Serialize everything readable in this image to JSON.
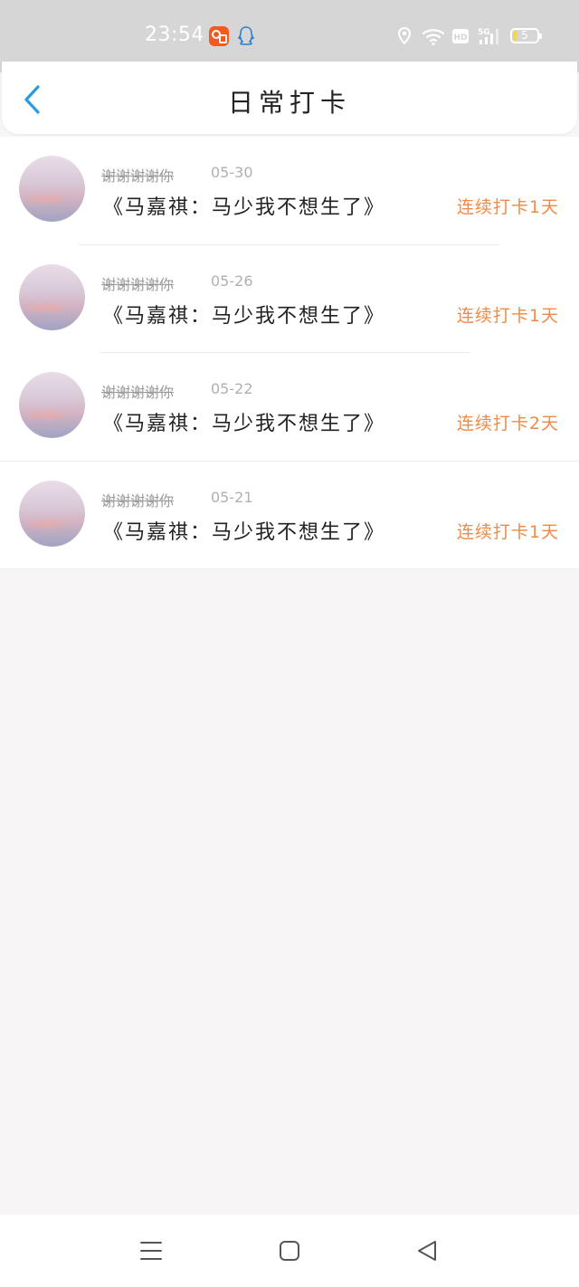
{
  "status_bar": {
    "time": "23:54",
    "battery_level": "5",
    "icons": [
      "app-icon",
      "qq-icon",
      "location-icon",
      "wifi-icon",
      "hd-icon",
      "signal-5g-icon",
      "battery-icon"
    ]
  },
  "header": {
    "title": "日常打卡",
    "back_icon": "chevron-left-icon"
  },
  "checkins": [
    {
      "username": "谢谢谢谢你",
      "date": "05-30",
      "title": "《马嘉祺：马少我不想生了》",
      "streak": "连续打卡1天"
    },
    {
      "username": "谢谢谢谢你",
      "date": "05-26",
      "title": "《马嘉祺：马少我不想生了》",
      "streak": "连续打卡1天"
    },
    {
      "username": "谢谢谢谢你",
      "date": "05-22",
      "title": "《马嘉祺：马少我不想生了》",
      "streak": "连续打卡2天"
    },
    {
      "username": "谢谢谢谢你",
      "date": "05-21",
      "title": "《马嘉祺：马少我不想生了》",
      "streak": "连续打卡1天"
    }
  ],
  "nav_bar": {
    "icons": [
      "menu-icon",
      "home-icon",
      "back-icon"
    ]
  },
  "colors": {
    "accent": "#2a9be0",
    "streak": "#f08a45",
    "status_bar_bg": "#d6d6d6",
    "page_bg": "#f7f5f6"
  }
}
